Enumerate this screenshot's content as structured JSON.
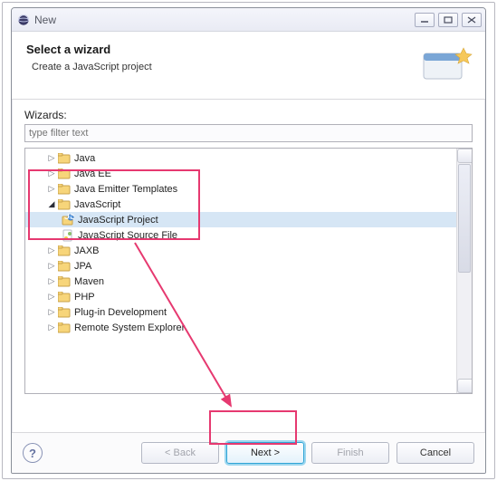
{
  "window": {
    "title": "New",
    "min_tip": "Minimize",
    "max_tip": "Maximize",
    "close_tip": "Close"
  },
  "header": {
    "title": "Select a wizard",
    "subtitle": "Create a JavaScript project"
  },
  "wizards": {
    "label": "Wizards:",
    "filter_placeholder": "type filter text",
    "items": {
      "java": "Java",
      "javaee": "Java EE",
      "jet": "Java Emitter Templates",
      "js": "JavaScript",
      "js_project": "JavaScript Project",
      "js_source": "JavaScript Source File",
      "jaxb": "JAXB",
      "jpa": "JPA",
      "maven": "Maven",
      "php": "PHP",
      "plugin": "Plug-in Development",
      "rse": "Remote System Explorer"
    }
  },
  "buttons": {
    "back": "< Back",
    "next": "Next >",
    "finish": "Finish",
    "cancel": "Cancel",
    "help": "?"
  },
  "scrollbar": {
    "up": "▲",
    "down": "▼"
  },
  "annotations": {
    "hb1_desc": "JavaScript wizard selection highlight",
    "hb2_desc": "Next button highlight"
  }
}
